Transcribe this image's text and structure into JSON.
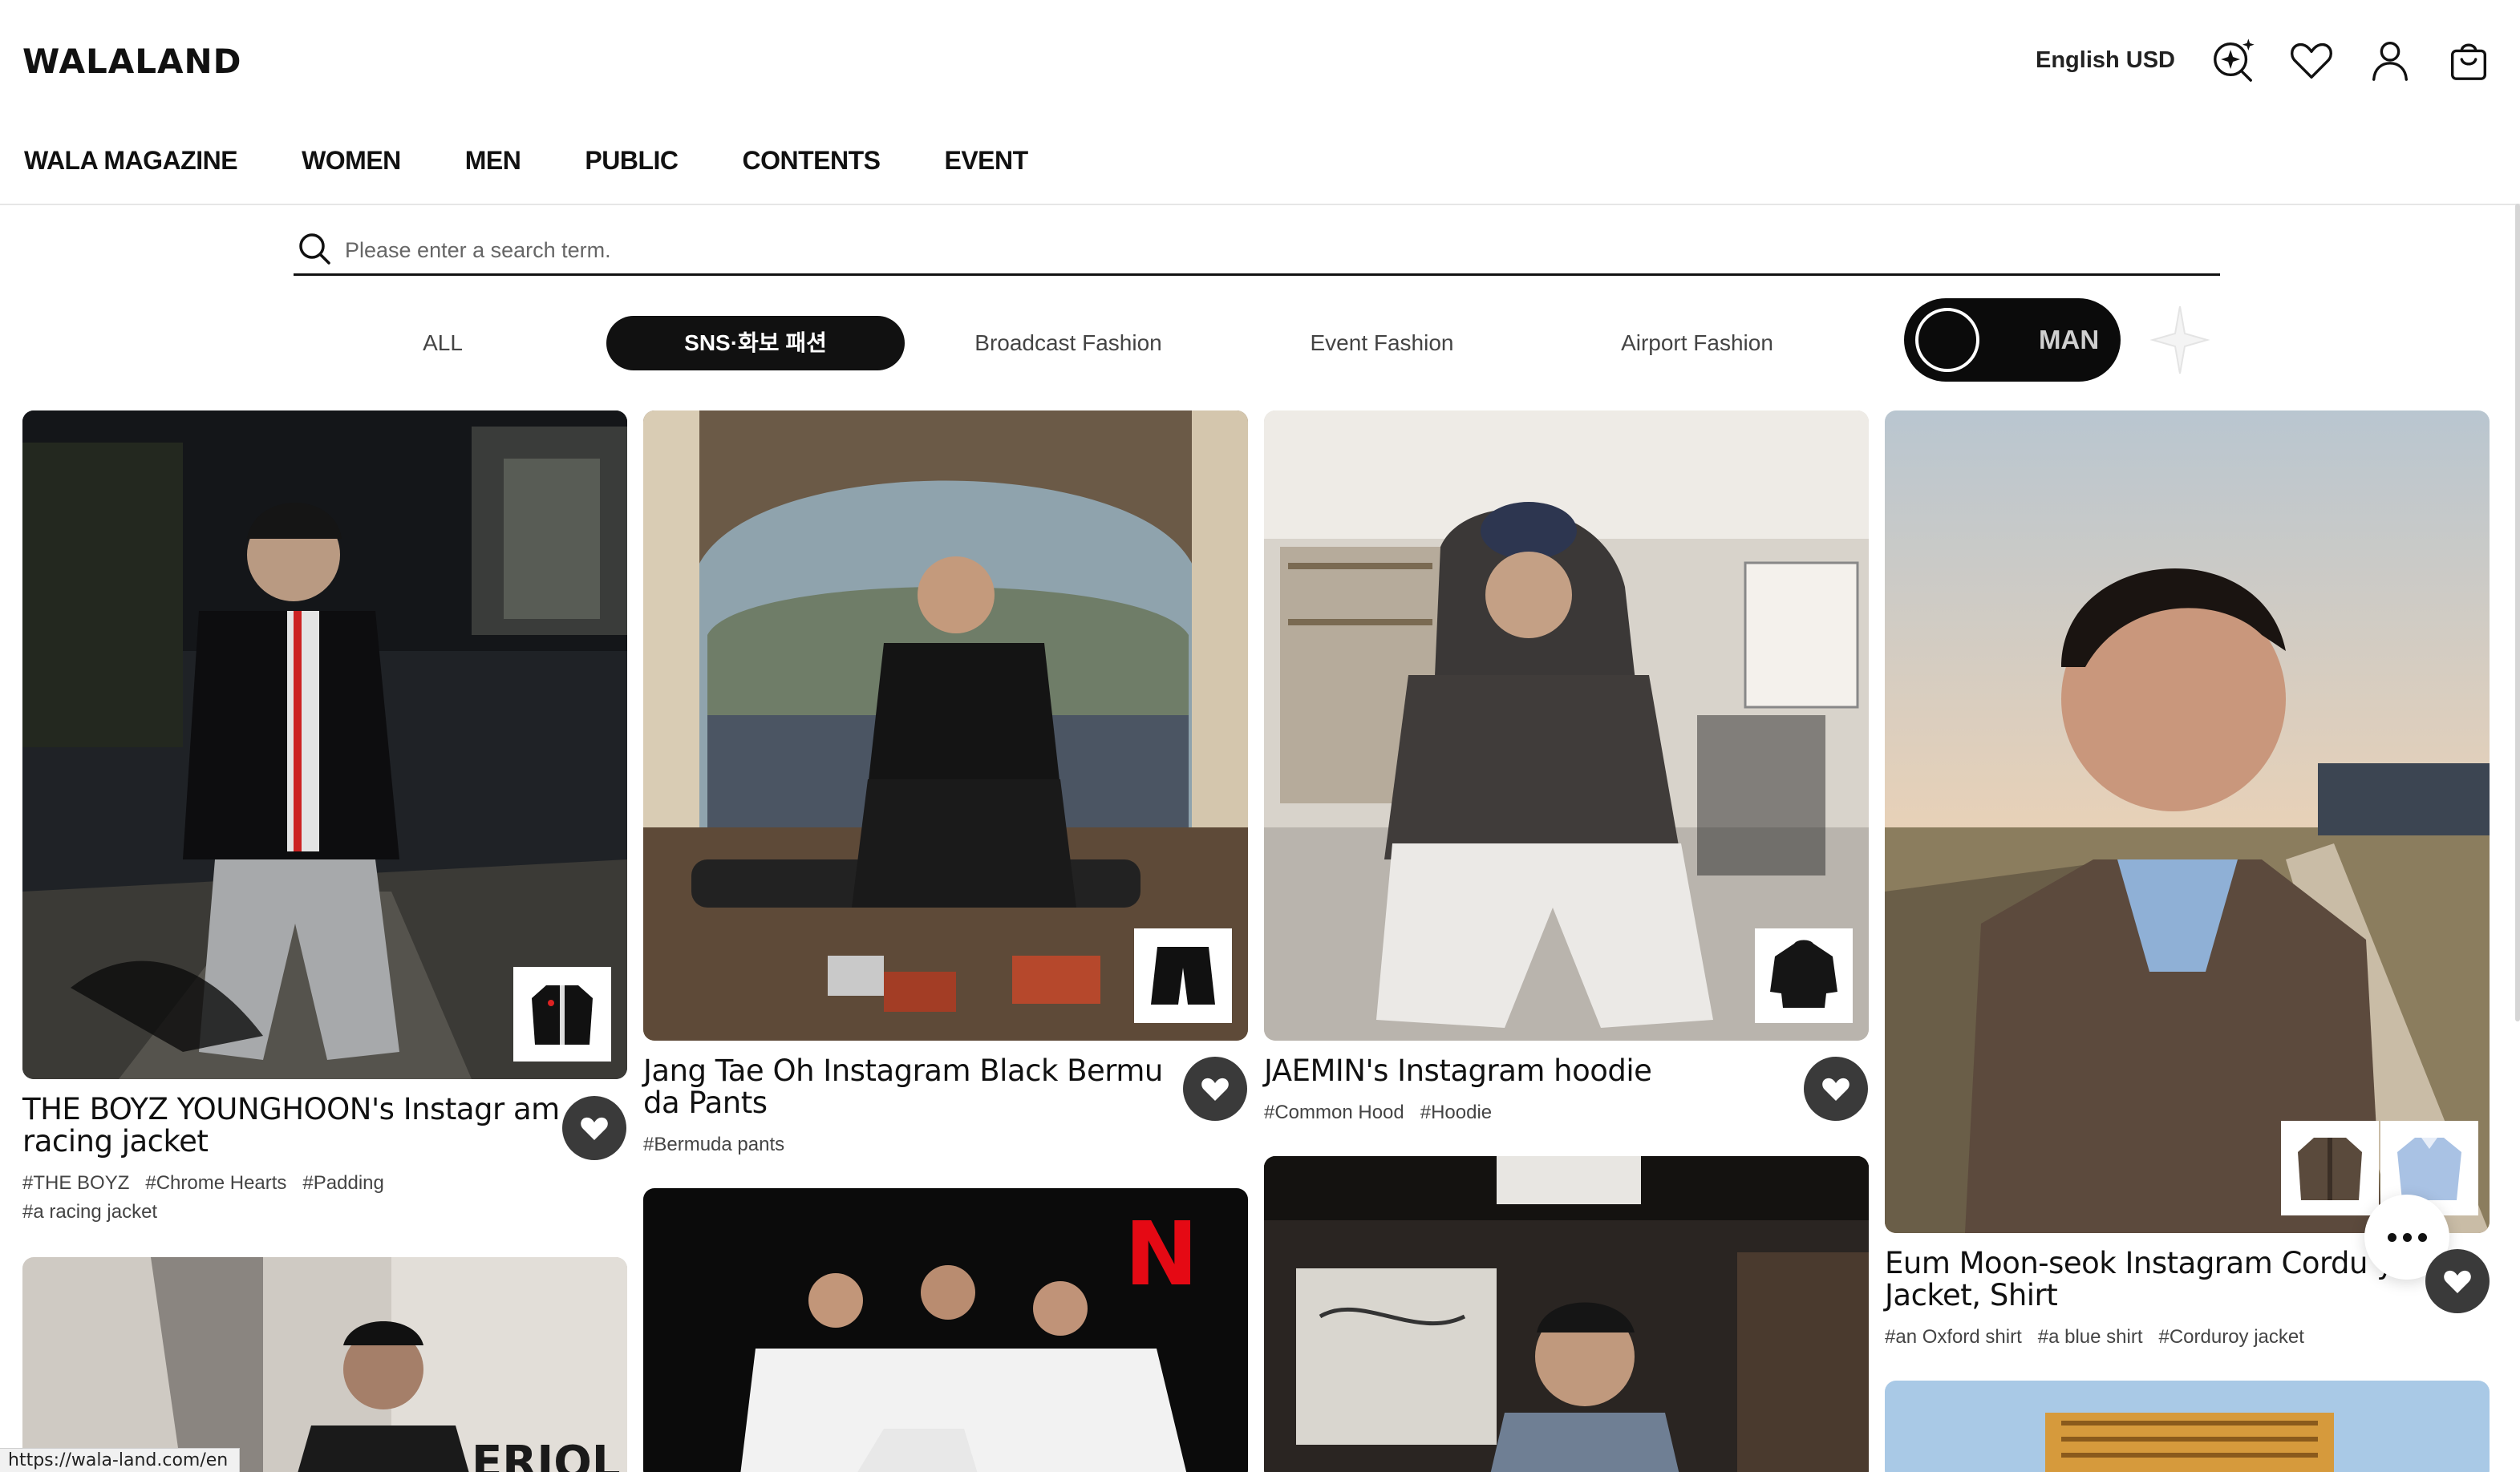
{
  "header": {
    "logo": "WALALAND",
    "language": "English USD",
    "icons": [
      "ai-search-icon",
      "heart-icon",
      "user-icon",
      "shopping-bag-icon"
    ]
  },
  "nav": {
    "items": [
      "WALA MAGAZINE",
      "WOMEN",
      "MEN",
      "PUBLIC",
      "CONTENTS",
      "EVENT"
    ]
  },
  "search": {
    "placeholder": "Please enter a search term."
  },
  "categories": {
    "items": [
      "ALL",
      "SNS·화보 패션",
      "Broadcast Fashion",
      "Event Fashion",
      "Airport Fashion"
    ],
    "active": "SNS·화보 패션"
  },
  "gender_toggle": {
    "label": "MAN"
  },
  "cards": [
    {
      "title": "THE BOYZ YOUNGHOON's Instagr am racing jacket",
      "tags": [
        "#THE BOYZ",
        "#Chrome Hearts",
        "#Padding",
        "#a racing jacket"
      ]
    },
    {
      "title": "Jang Tae Oh Instagram Black Bermu da Pants",
      "tags": [
        "#Bermuda pants"
      ]
    },
    {
      "title": "JAEMIN's Instagram hoodie",
      "tags": [
        "#Common Hood",
        "#Hoodie"
      ]
    },
    {
      "title": "Eum Moon-seok Instagram Cordu y Jacket, Shirt",
      "tags": [
        "#an Oxford shirt",
        "#a blue shirt",
        "#Corduroy jacket"
      ]
    }
  ],
  "colors": {
    "primary": "#111111",
    "like_bg": "#3a3a3a",
    "netflix_red": "#e50914"
  },
  "status_url": "https://wala-land.com/en"
}
